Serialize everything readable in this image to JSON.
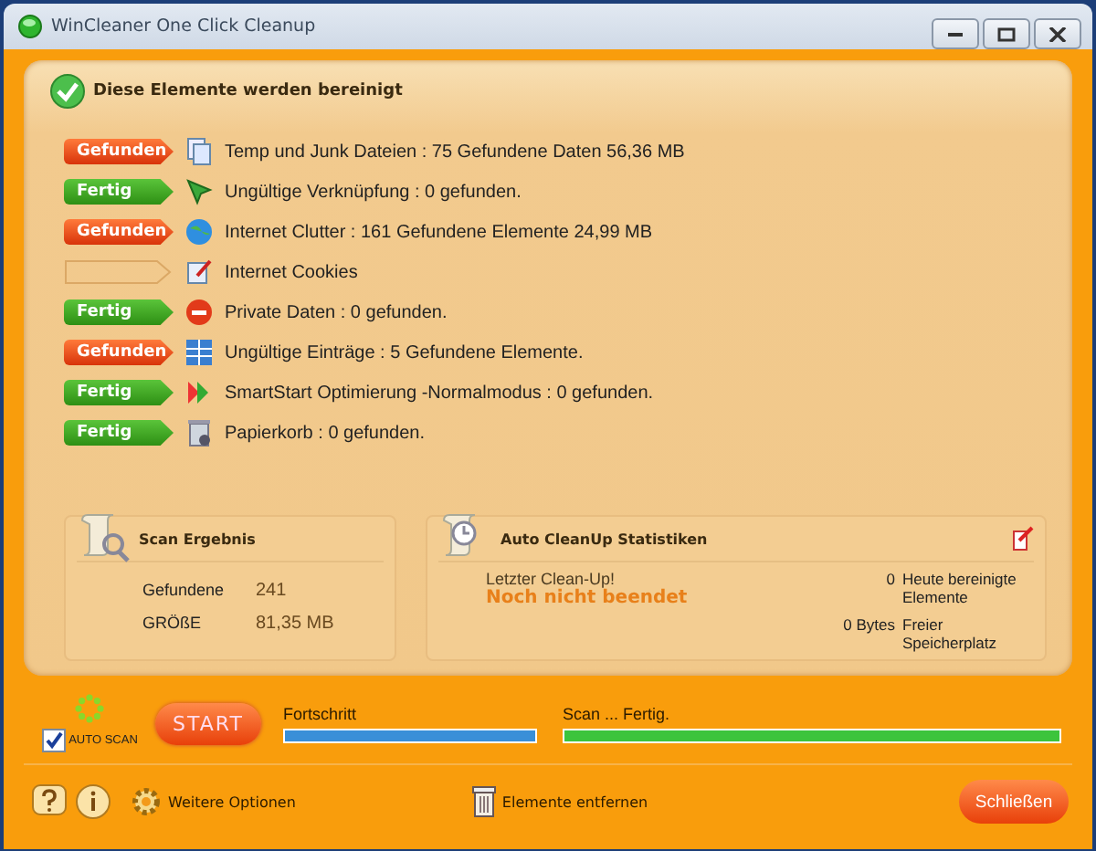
{
  "window": {
    "title": "WinCleaner One Click Cleanup"
  },
  "header": {
    "title": "Diese Elemente werden bereinigt"
  },
  "items": [
    {
      "kind": "found",
      "badge": "Gefunden",
      "text": "Temp und Junk Dateien : 75 Gefundene Daten 56,36 MB"
    },
    {
      "kind": "done",
      "badge": "Fertig",
      "text": "Ungültige Verknüpfung : 0 gefunden."
    },
    {
      "kind": "found",
      "badge": "Gefunden",
      "text": "Internet Clutter : 161 Gefundene Elemente 24,99 MB"
    },
    {
      "kind": "pending",
      "text": "Internet Cookies"
    },
    {
      "kind": "done",
      "badge": "Fertig",
      "text": "Private Daten : 0 gefunden."
    },
    {
      "kind": "found",
      "badge": "Gefunden",
      "text": "Ungültige Einträge : 5 Gefundene Elemente."
    },
    {
      "kind": "done",
      "badge": "Fertig",
      "text": "SmartStart Optimierung -Normalmodus : 0 gefunden."
    },
    {
      "kind": "done",
      "badge": "Fertig",
      "text": "Papierkorb : 0 gefunden."
    }
  ],
  "scan_result": {
    "title": "Scan Ergebnis",
    "rows": [
      {
        "label": "Gefundene",
        "value": "241"
      },
      {
        "label": "GRÖßE",
        "value": "81,35 MB"
      }
    ]
  },
  "auto_stats": {
    "title": "Auto CleanUp Statistiken",
    "last_label": "Letzter Clean-Up!",
    "last_value": "Noch nicht beendet",
    "rows": [
      {
        "value": "0",
        "label": "Heute bereinigte Elemente"
      },
      {
        "value": "0 Bytes",
        "label": "Freier Speicherplatz"
      }
    ]
  },
  "auto_scan": {
    "label": "AUTO SCAN",
    "checked": true
  },
  "start_button": "START",
  "progress": [
    {
      "label": "Fortschritt",
      "level": 1,
      "color": "#3a8fd8"
    },
    {
      "label": "Scan ... Fertig.",
      "level": 1,
      "color": "#3cc43c"
    }
  ],
  "footer": {
    "options": "Weitere Optionen",
    "remove": "Elemente entfernen",
    "close": "Schließen"
  }
}
